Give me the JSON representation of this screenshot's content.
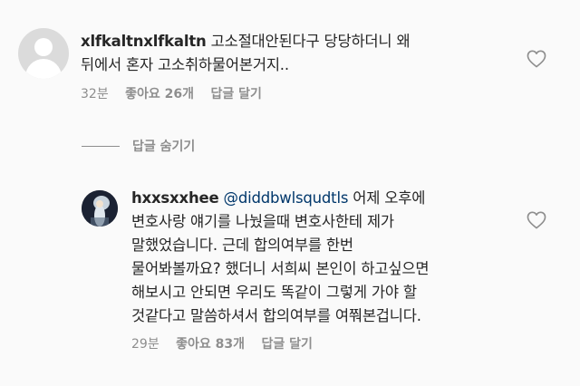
{
  "comment1": {
    "username": "xlfkaltnxlfkaltn",
    "text_line1": "고소절대안된다구 당당하더니 왜",
    "text_line2": "뒤에서 혼자 고소취하물어본거지..",
    "time": "32분",
    "likes": "좋아요 26개",
    "reply": "답글 달기",
    "like_icon": "heart-outline-icon"
  },
  "hide_replies": {
    "label": "답글 숨기기"
  },
  "comment2": {
    "username": "hxxsxxhee",
    "mention": "@diddbwlsqudtls",
    "text_line1_rest": " 어제 오후에",
    "text_line2": "변호사랑 얘기를 나눴을때 변호사한테 제가",
    "text_line3": "말했었습니다. 근데 합의여부를 한번",
    "text_line4": "물어봐볼까요? 했더니 서희씨 본인이 하고싶으면",
    "text_line5": "해보시고 안되면 우리도 똑같이 그렇게 가야 할",
    "text_line6": "것같다고 말씀하셔서 합의여부를 여쭤본겁니다.",
    "time": "29분",
    "likes": "좋아요 83개",
    "reply": "답글 달기",
    "like_icon": "heart-outline-icon"
  },
  "colors": {
    "text": "#262626",
    "meta": "#8e8e8e",
    "mention": "#00376b",
    "background": "#fafafa"
  }
}
